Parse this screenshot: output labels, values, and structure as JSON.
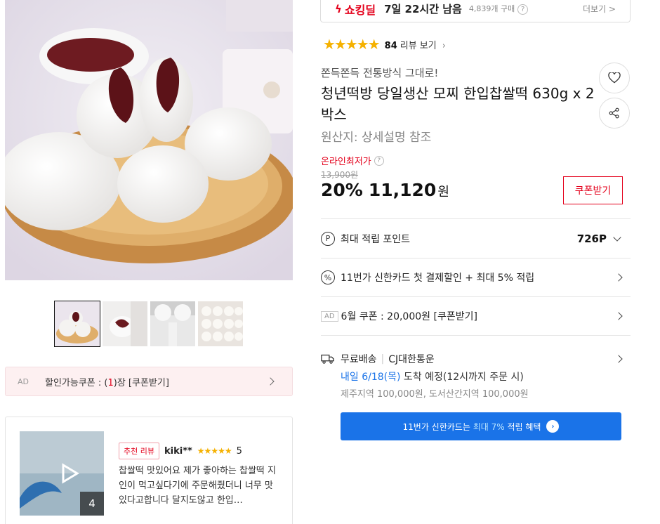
{
  "deal": {
    "label": "쇼킹딜",
    "time_left": "7일 22시간 남음",
    "buyers": "4,839개 구매",
    "more": "더보기 >"
  },
  "rating": {
    "stars": "★★★★★",
    "count": "84",
    "link_label": "리뷰 보기"
  },
  "product": {
    "subtitle": "쫀득쫀득 전통방식 그대로!",
    "title": "청년떡방 당일생산 모찌 한입찹쌀떡 630g x 2박스",
    "origin": "원산지: 상세설명 참조"
  },
  "price": {
    "lowest_label": "온라인최저가",
    "original": "13,900원",
    "discount": "20%",
    "amount": "11,120",
    "currency": "원",
    "coupon_button": "쿠폰받기"
  },
  "benefits": {
    "points_label": "최대 적립 포인트",
    "points_value": "726P",
    "card_discount": "11번가 신한카드 첫 결제할인 + 최대 5% 적립",
    "ad_badge": "AD",
    "june_coupon": "6월 쿠폰 : 20,000원 [쿠폰받기]"
  },
  "shipping": {
    "type": "무료배송",
    "carrier": "CJ대한통운",
    "arrival_date": "내일 6/18(목)",
    "arrival_suffix": "도착 예정(12시까지 주문 시)",
    "extra_fee": "제주지역 100,000원, 도서산간지역 100,000원"
  },
  "card_banner": {
    "prefix": "11번가 신한카드는",
    "highlight": "최대 7%",
    "suffix": "적립 혜택"
  },
  "left_coupon": {
    "ad": "AD",
    "text_prefix": "할인가능쿠폰 : (",
    "count": "1",
    "text_suffix": ")장 [쿠폰받기]"
  },
  "review": {
    "badge": "추천 리뷰",
    "reviewer": "kiki**",
    "stars": "★★★★★",
    "score": "5",
    "text": "찹쌀떡 맛있어요 제가 좋아하는 찹쌀떡 지인이 먹고싶다기에 주문해줬더니 너무 맛있다고합니다 달지도않고 한입…",
    "photo_count": "4"
  },
  "colors": {
    "accent_red": "#e4001b",
    "star_yellow": "#f5b100",
    "banner_blue": "#1a73e8"
  }
}
